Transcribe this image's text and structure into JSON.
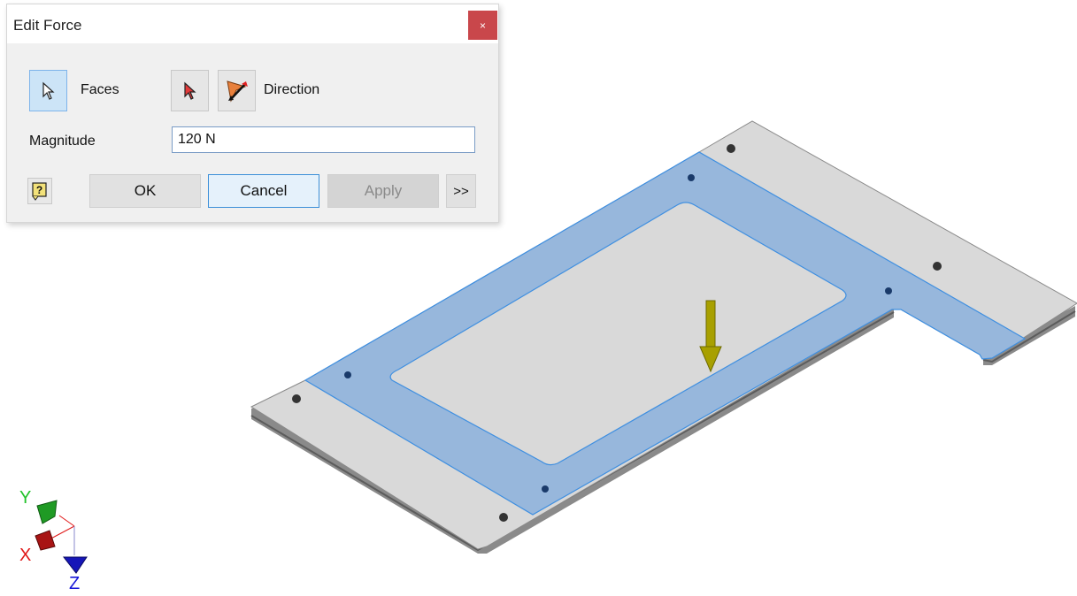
{
  "dialog": {
    "title": "Edit Force",
    "close_label": "×",
    "faces_label": "Faces",
    "direction_label": "Direction",
    "magnitude_label": "Magnitude",
    "magnitude_value": "120 N",
    "ok_label": "OK",
    "cancel_label": "Cancel",
    "apply_label": "Apply",
    "more_label": ">>"
  },
  "icons": {
    "faces_select": "cursor-arrow-icon",
    "direction_select": "red-cursor-arrow-icon",
    "flip_direction": "flip-direction-icon",
    "help": "help-question-icon",
    "force_arrow": "force-arrow-glyph"
  },
  "triad": {
    "y_label": "Y",
    "x_label": "X",
    "z_label": "Z"
  },
  "colors": {
    "selected_face": "#97b7dc",
    "part_body": "#d9d9d9",
    "force_arrow": "#a8a000",
    "close_button": "#c9474b",
    "x_axis": "#e01818",
    "y_axis": "#22c22a",
    "z_axis": "#1616d8"
  }
}
